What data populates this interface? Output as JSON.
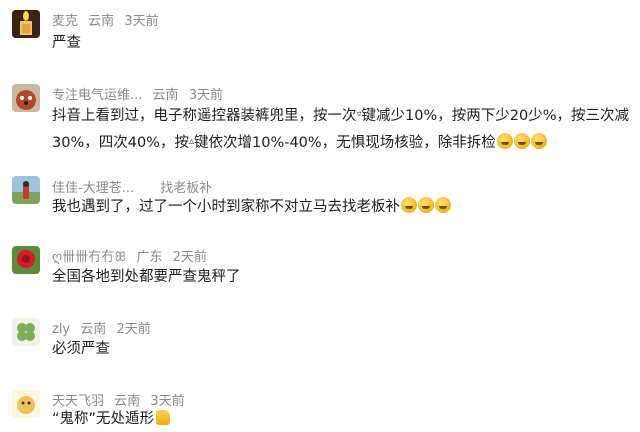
{
  "comments": [
    {
      "user": "麦克",
      "location": "云南",
      "time": "3天前",
      "text": "严查",
      "avatar_icon": "candle-avatar"
    },
    {
      "user": "专注电气运维...",
      "location": "云南",
      "time": "3天前",
      "text_line1": "抖音上看到过，电子称遥控器装裤兜里，按一次",
      "text_line1b": "键减少10%，按两下少20少%，按三次减",
      "text_line2a": "30%，四次40%，按",
      "text_line2b": "键依次增10%-40%，无惧现场核验，除非拆检",
      "sym1": "▿",
      "sym2": "▵",
      "avatar_icon": "red-panda-avatar"
    },
    {
      "user": "佳佳-大理苍...",
      "location": "",
      "time": "找老板补",
      "text": "我也遇到了，过了一个小时到家称不对立马去找老板补",
      "avatar_icon": "person-field-avatar"
    },
    {
      "user": "ღ卌卌冇冇ꕥ",
      "location": "广东",
      "time": "2天前",
      "text": "全国各地到处都要严查鬼秤了",
      "avatar_icon": "rose-avatar"
    },
    {
      "user": "zly",
      "location": "云南",
      "time": "2天前",
      "text": "必须严查",
      "avatar_icon": "clover-avatar"
    },
    {
      "user": "天天飞羽",
      "location": "云南",
      "time": "3天前",
      "text": "“鬼称”无处遁形",
      "avatar_icon": "cartoon-avatar"
    }
  ]
}
